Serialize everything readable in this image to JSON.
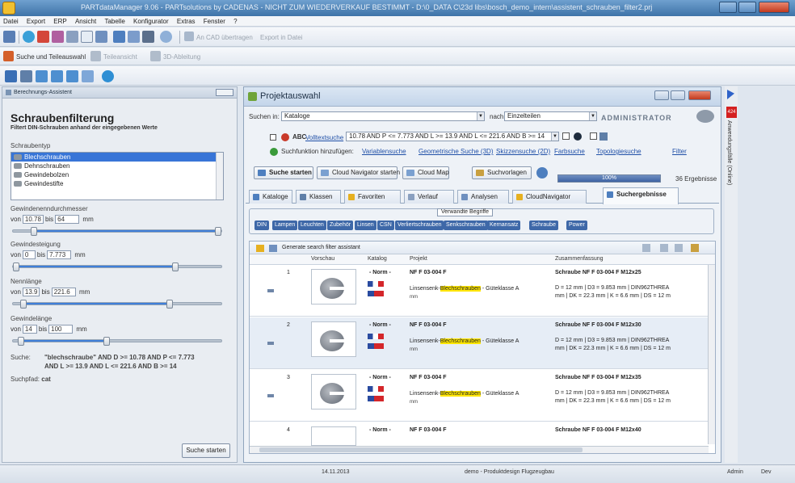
{
  "window": {
    "title": "PARTdataManager 9.06 - PARTsolutions by CADENAS - NICHT ZUM WIEDERVERKAUF BESTIMMT - D:\\0_DATA C\\23d libs\\bosch_demo_intern\\assistent_schrauben_filter2.prj"
  },
  "menu": [
    "Datei",
    "Export",
    "ERP",
    "Ansicht",
    "Tabelle",
    "Konfigurator",
    "Extras",
    "Fenster",
    "?"
  ],
  "toolbar1": {
    "cad_transfer": "An CAD übertragen",
    "export_file": "Export in Datei"
  },
  "toolbar2": {
    "search_parts": "Suche und Teileauswahl",
    "part_view": "Teileansicht",
    "view_3d": "3D-Ableitung"
  },
  "left": {
    "header": "Berechnungs-Assistent",
    "title": "Schraubenfilterung",
    "subtitle": "Filtert DIN-Schrauben anhand der eingegebenen Werte",
    "type_label": "Schraubentyp",
    "types": [
      "Blechschrauben",
      "Dehnschrauben",
      "Gewindebolzen",
      "Gewindestifte"
    ],
    "fields": [
      {
        "label": "Gewindenenndurchmesser",
        "from_label": "von",
        "from": "10.78",
        "to_label": "bis",
        "to": "64",
        "unit": "mm"
      },
      {
        "label": "Gewindesteigung",
        "from_label": "von",
        "from": "0",
        "to_label": "bis",
        "to": "7.773",
        "unit": "mm"
      },
      {
        "label": "Nennlänge",
        "from_label": "von",
        "from": "13.9",
        "to_label": "bis",
        "to": "221.6",
        "unit": "mm"
      },
      {
        "label": "Gewindelänge",
        "from_label": "von",
        "from": "14",
        "to_label": "bis",
        "to": "100",
        "unit": "mm"
      }
    ],
    "sliders": [
      {
        "from_pct": 0.1,
        "to_pct": 1.0
      },
      {
        "from_pct": 0.0,
        "to_pct": 0.78
      },
      {
        "from_pct": 0.05,
        "to_pct": 0.75
      },
      {
        "from_pct": 0.04,
        "to_pct": 0.45
      }
    ],
    "query_label": "Suche:",
    "query_line1": "\"blechschraube\" AND D >= 10.78 AND P <= 7.773",
    "query_line2": "AND L >= 13.9 AND L <= 221.6 AND B >= 14",
    "path_label": "Suchpfad:",
    "path_value": "cat",
    "start_button": "Suche starten"
  },
  "main": {
    "title": "Projektauswahl",
    "search_in_label": "Suchen in:",
    "search_in_value": "Kataloge",
    "after_label": "nach",
    "after_value": "Einzelteilen",
    "brand": "ADMINISTRATOR",
    "fulltext_label": "Volltextsuche",
    "fulltext_value": "10.78 AND P <= 7.773 AND L >= 13.9 AND L <= 221.6 AND B >= 14",
    "add_search_label": "Suchfunktion hinzufügen:",
    "search_funcs": [
      "Variablensuche",
      "Geometrische Suche (3D)",
      "Skizzensuche (2D)",
      "Farbsuche",
      "Topologiesuche",
      "Filter"
    ],
    "buttons": {
      "start": "Suche starten",
      "cloud_nav": "Cloud Navigator starten",
      "cloud_map": "Cloud Map",
      "templates": "Suchvorlagen"
    },
    "progress_value": 1.0,
    "progress_label": "100%",
    "result_count": "36 Ergebnisse",
    "tabs": [
      "Kataloge",
      "Klassen",
      "Favoriten",
      "Verlauf",
      "Analysen",
      "CloudNavigator",
      "Suchergebnisse"
    ],
    "related_label": "Verwandte Begriffe",
    "related": [
      "DIN",
      "Lampen",
      "Leuchten",
      "Zubehör",
      "Linsen",
      "CSN",
      "Verliertschrauben",
      "Senkschrauben",
      "Kernansatz",
      "Schraube",
      "Power"
    ],
    "filter_assistant": "Generate search filter assistant",
    "columns": [
      "Vorschau",
      "Katalog",
      "Projekt",
      "Zusammenfassung"
    ],
    "rows": [
      {
        "num": "1",
        "norm": "- Norm -",
        "project": "NF F 03-004 F",
        "desc_pre": "Linsensenk-",
        "desc_hl": "Blechschrauben",
        "desc_post": " - Güteklasse A",
        "title": "Schraube NF F 03-004 F M12x25"
      },
      {
        "num": "2",
        "norm": "- Norm -",
        "project": "NF F 03-004 F",
        "desc_pre": "Linsensenk-",
        "desc_hl": "Blechschrauben",
        "desc_post": " - Güteklasse A",
        "title": "Schraube NF F 03-004 F M12x30"
      },
      {
        "num": "3",
        "norm": "- Norm -",
        "project": "NF F 03-004 F",
        "desc_pre": "Linsensenk-",
        "desc_hl": "Blechschrauben",
        "desc_post": " - Güteklasse A",
        "title": "Schraube NF F 03-004 F M12x35"
      },
      {
        "num": "4",
        "norm": "- Norm -",
        "project": "NF F 03-004 F",
        "desc_pre": "",
        "desc_hl": "",
        "desc_post": "",
        "title": "Schraube NF F 03-004 F M12x40"
      }
    ],
    "summary_line1": "D = 12 mm | D3 = 9.853 mm | DIN962THREA",
    "summary_line2": "mm | DK = 22.3 mm | K = 6.6 mm | DS = 12 m",
    "unit_small": "mm"
  },
  "side": {
    "badge": "424",
    "label": "Anwendungsfälle (Online)"
  },
  "status": {
    "date": "14.11.2013",
    "project": "demo - Produktdesign Flugzeugbau",
    "user": "Admin",
    "mode": "Dev"
  }
}
